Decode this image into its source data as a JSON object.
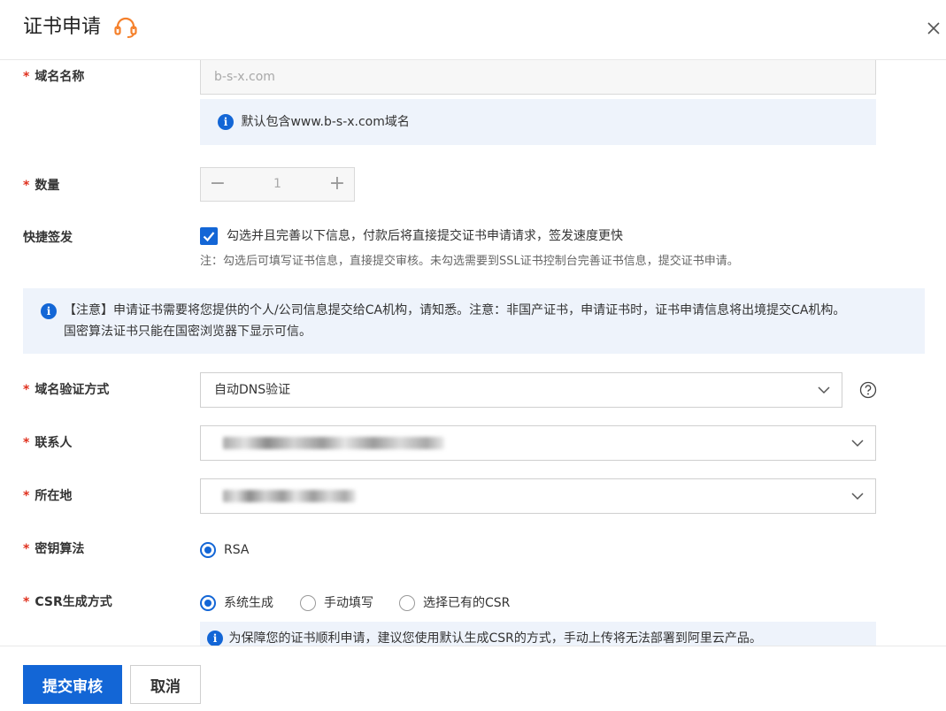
{
  "dialog": {
    "title": "证书申请"
  },
  "fields": {
    "domain": {
      "label": "域名名称",
      "required": "*",
      "value": "b-s-x.com",
      "info": "默认包含www.b-s-x.com域名"
    },
    "quantity": {
      "label": "数量",
      "required": "*",
      "value": "1",
      "minus": "−",
      "plus": "+"
    },
    "quick_issue": {
      "label": "快捷签发",
      "checkbox_text": "勾选并且完善以下信息，付款后将直接提交证书申请请求，签发速度更快",
      "note": "注：勾选后可填写证书信息，直接提交审核。未勾选需要到SSL证书控制台完善证书信息，提交证书申请。"
    },
    "notice": {
      "line1": "【注意】申请证书需要将您提供的个人/公司信息提交给CA机构，请知悉。注意：非国产证书，申请证书时，证书申请信息将出境提交CA机构。",
      "line2": "国密算法证书只能在国密浏览器下显示可信。"
    },
    "verify_method": {
      "label": "域名验证方式",
      "required": "*",
      "value": "自动DNS验证"
    },
    "contact": {
      "label": "联系人",
      "required": "*"
    },
    "location": {
      "label": "所在地",
      "required": "*"
    },
    "key_algo": {
      "label": "密钥算法",
      "required": "*",
      "option": "RSA"
    },
    "csr": {
      "label": "CSR生成方式",
      "required": "*",
      "options": [
        "系统生成",
        "手动填写",
        "选择已有的CSR"
      ],
      "info": "为保障您的证书顺利申请，建议您使用默认生成CSR的方式，手动上传将无法部署到阿里云产品。"
    }
  },
  "footer": {
    "submit": "提交审核",
    "cancel": "取消"
  },
  "colors": {
    "primary": "#1366d6",
    "required": "#e0321f",
    "accent_icon": "#f5802b",
    "info_bg": "#eef3fb"
  }
}
